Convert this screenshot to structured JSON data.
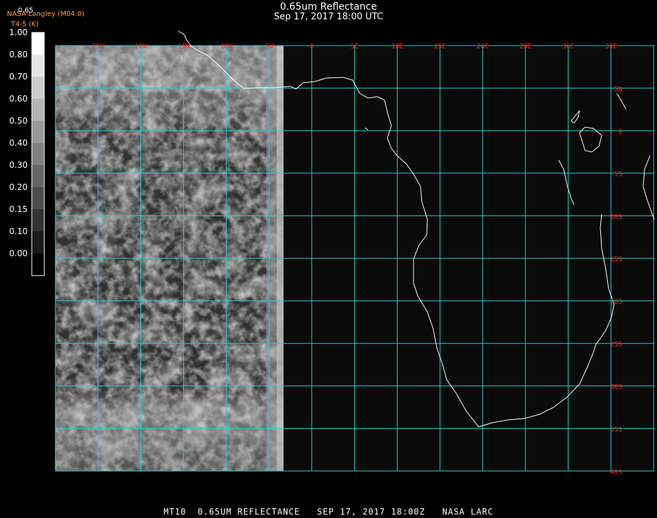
{
  "header": {
    "title": "0.65um Reflectance",
    "datetime": "Sep 17, 2017 18:00 UTC",
    "credit": "NASA Langley (M04.0)",
    "credit_sub": "T4-5 (K)",
    "channel": "0.65"
  },
  "colorbar": {
    "labels": [
      "1.00",
      "0.80",
      "0.70",
      "0.60",
      "0.50",
      "0.40",
      "0.30",
      "0.20",
      "0.15",
      "0.10",
      "0.00"
    ]
  },
  "map": {
    "longitude_labels": [
      "25W",
      "20W",
      "15W",
      "10W",
      "5W",
      "0",
      "5E",
      "10E",
      "15E",
      "20E",
      "25E",
      "30E",
      "35E"
    ],
    "latitude_labels": [
      "5N",
      "0",
      "5S",
      "10S",
      "15S",
      "20S",
      "25S",
      "30S",
      "35S",
      "40S"
    ],
    "colors": {
      "grid": "#20d0d0",
      "labels": "#ff2020",
      "coastline": "#ffffff",
      "background": "#0a0a0a"
    }
  },
  "footer": {
    "text": "MT10  0.65UM REFLECTANCE   SEP 17, 2017 18:00Z   NASA LARC"
  }
}
